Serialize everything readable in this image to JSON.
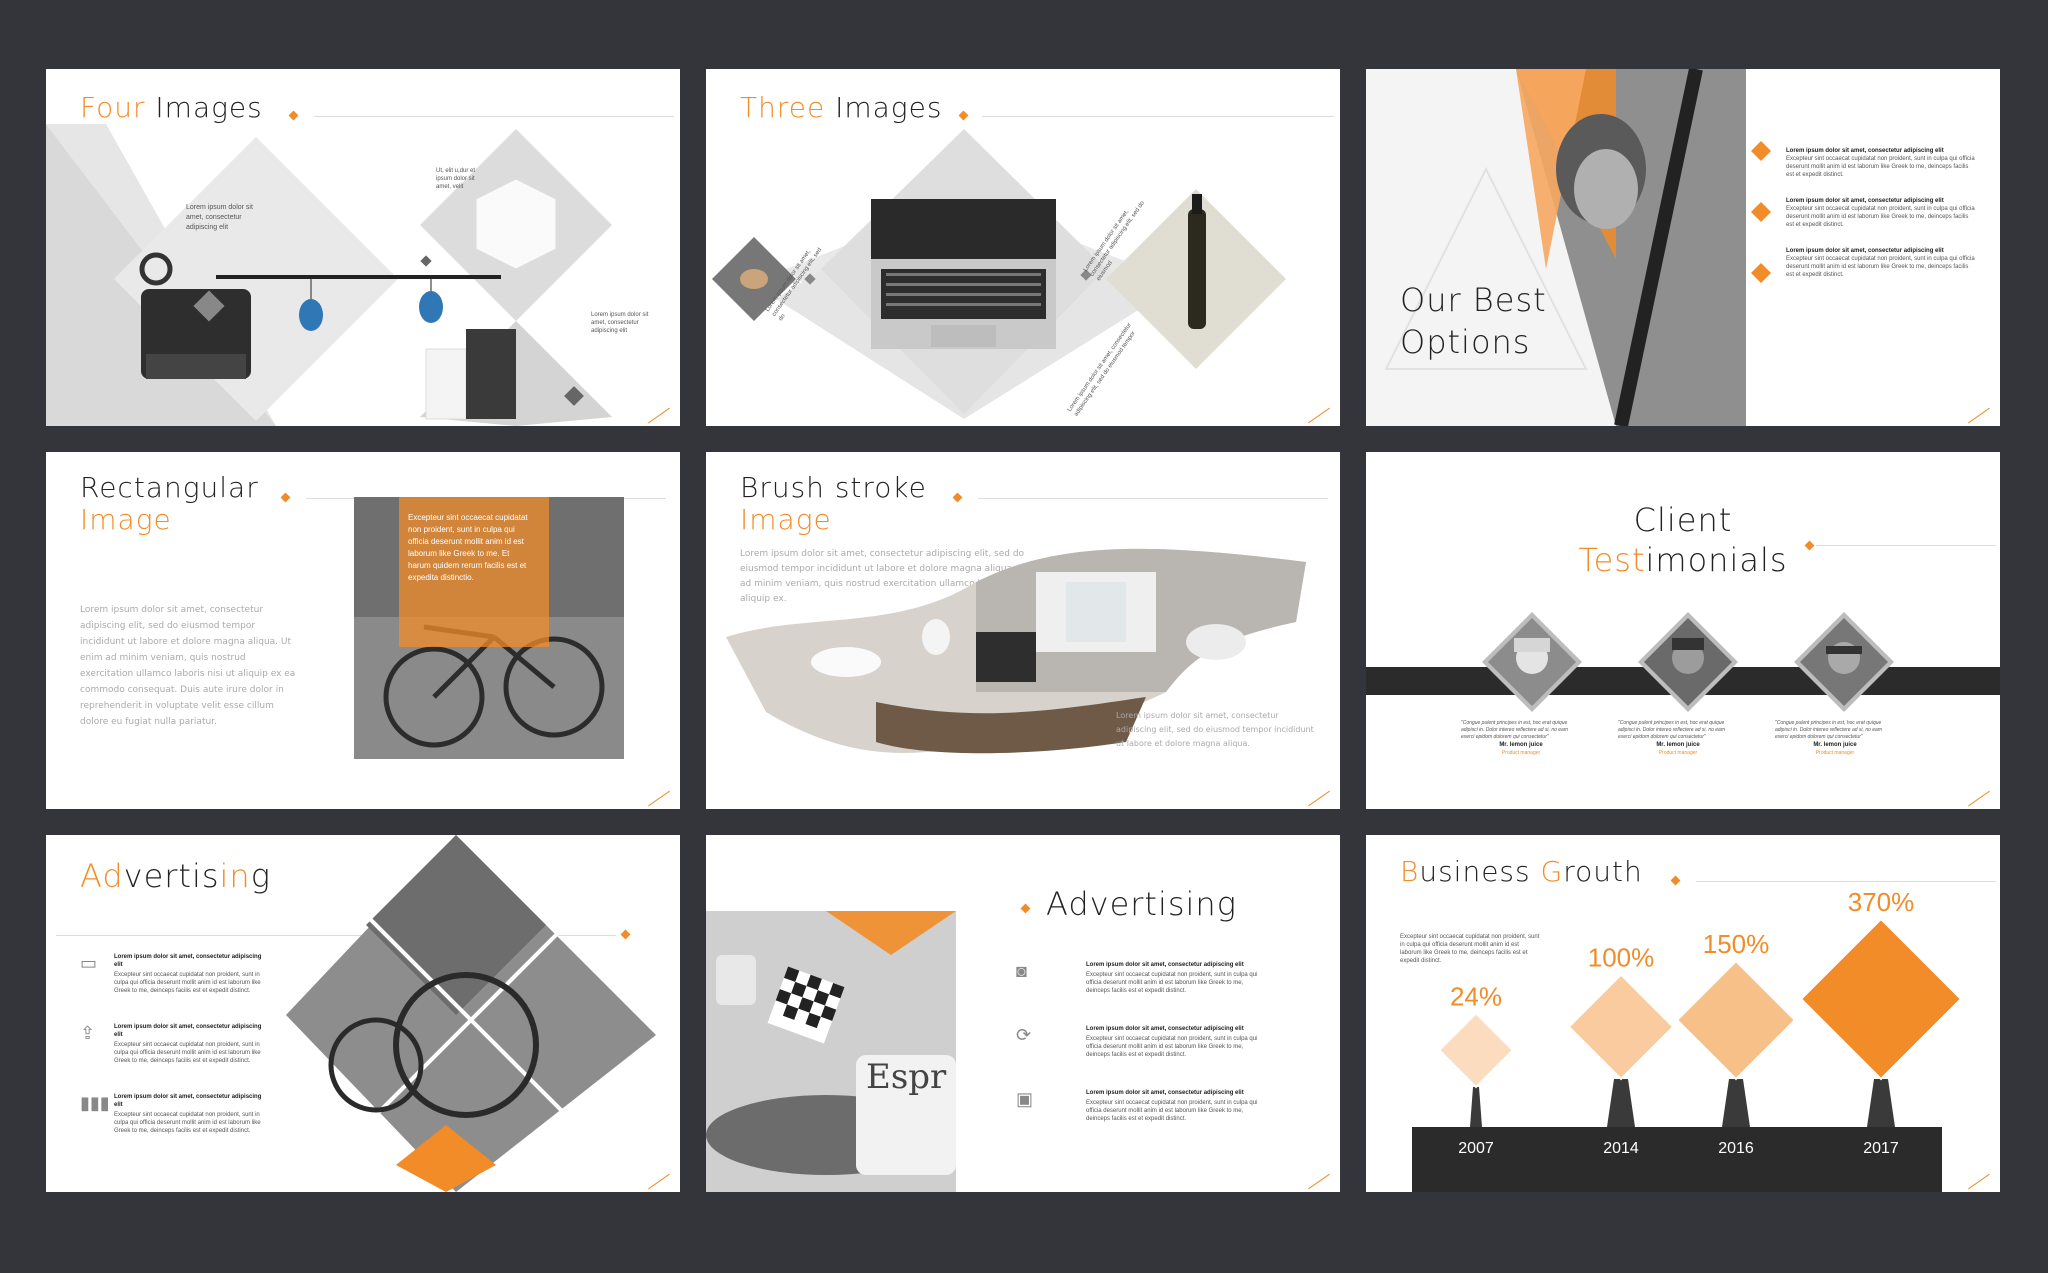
{
  "colors": {
    "accent": "#f28c28",
    "background": "#34353a",
    "dark": "#2b2b2b"
  },
  "slides": {
    "four_images": {
      "title_a": "Four",
      "title_b": "Images",
      "text1": "Lorem ipsum dolor sit amet, consectetur adipiscing elit",
      "text2": "Ut, elit u,dur et ipsum dolor sit amet, velit",
      "text3": "Lorem ipsum dolor sit amet, consectetur adipiscing elit"
    },
    "three_images": {
      "title_a": "Three",
      "title_b": "Images",
      "text1": "Lorem ipsum dolor sit amet, consectetur adipiscing elit, sed do",
      "text2": "Lorem ipsum dolor sit amet, consectetur adipiscing elit, sed do eiusmod",
      "text3": "Lorem ipsum dolor sit amet, consectetur adipiscing elit, sed do eiusmod tempor"
    },
    "best_options": {
      "title_line1": "Our Best",
      "title_line2": "Options",
      "items": [
        {
          "head": "Lorem ipsum dolor sit amet, consectetur adipiscing elit",
          "body": "Excepteur sint occaecat cupidatat non proident, sunt in culpa qui officia deserunt mollit anim id est laborum like Greek to me, deinceps facilis est et expedit distinct."
        },
        {
          "head": "Lorem ipsum dolor sit amet, consectetur adipiscing elit",
          "body": "Excepteur sint occaecat cupidatat non proident, sunt in culpa qui officia deserunt mollit anim id est laborum like Greek to me, deinceps facilis est et expedit distinct."
        },
        {
          "head": "Lorem ipsum dolor sit amet, consectetur adipiscing elit",
          "body": "Excepteur sint occaecat cupidatat non proident, sunt in culpa qui officia deserunt mollit anim id est laborum like Greek to me, deinceps facilis est et expedit distinct."
        }
      ]
    },
    "rectangular": {
      "title_a": "Rectangular",
      "title_b": "Image",
      "body": "Lorem ipsum dolor sit amet, consectetur adipiscing elit, sed do eiusmod tempor incididunt ut labore et dolore magna aliqua. Ut enim ad minim veniam, quis nostrud exercitation ullamco laboris nisi ut aliquip ex ea commodo consequat. Duis aute irure dolor in reprehenderit in voluptate velit esse cillum dolore eu fugiat nulla pariatur.",
      "overlay": "Excepteur sint occaecat cupidatat non proident, sunt in culpa qui officia deserunt mollit anim id est laborum like Greek to me. Et harum quidem rerum facilis est et expedita distinctio."
    },
    "brush": {
      "title_a": "Brush stroke",
      "title_b": "Image",
      "body1": "Lorem ipsum dolor sit amet, consectetur adipiscing elit, sed do eiusmod tempor incididunt ut labore et dolore magna aliqua. Ut enim ad minim veniam, quis nostrud exercitation ullamco laboris nisi ut aliquip ex.",
      "body2": "Lorem ipsum dolor sit amet, consectetur adipiscing elit, sed do eiusmod tempor incididunt ut labore et dolore magna aliqua."
    },
    "testimonials": {
      "title_a": "Client",
      "title_b1": "Test",
      "title_b2": "imonials",
      "people": [
        {
          "quote": "\"Congue pulent principes in est, hoc erat quique adipisci in. Dolor intereo reflectere ad si, no eam exerci epidom dolorem qui consectetur\"",
          "name": "Mr. lemon juice",
          "role": "Product manager"
        },
        {
          "quote": "\"Congue pulent principes in est, hoc erat quique adipisci in. Dolor intereo reflectere ad si, no eam exerci epidom dolorem qui consectetur\"",
          "name": "Mr. lemon juice",
          "role": "Product manager"
        },
        {
          "quote": "\"Congue pulent principes in est, hoc erat quique adipisci in. Dolor intereo reflectere ad si, no eam exerci epidom dolorem qui consectetur\"",
          "name": "Mr. lemon juice",
          "role": "Product manager"
        }
      ]
    },
    "advertising1": {
      "t1": "Ad",
      "t2": "vertis",
      "t3": "in",
      "t4": "g",
      "items": [
        {
          "head": "Lorem ipsum dolor sit amet, consectetur adipiscing elit",
          "body": "Excepteur sint occaecat cupidatat non proident, sunt in culpa qui officia deserunt mollit anim id est laborum like Greek to me, deinceps facilis est et expedit distinct."
        },
        {
          "head": "Lorem ipsum dolor sit amet, consectetur adipiscing elit",
          "body": "Excepteur sint occaecat cupidatat non proident, sunt in culpa qui officia deserunt mollit anim id est laborum like Greek to me, deinceps facilis est et expedit distinct."
        },
        {
          "head": "Lorem ipsum dolor sit amet, consectetur adipiscing elit",
          "body": "Excepteur sint occaecat cupidatat non proident, sunt in culpa qui officia deserunt mollit anim id est laborum like Greek to me, deinceps facilis est et expedit distinct."
        }
      ]
    },
    "advertising2": {
      "title": "Advertising",
      "items": [
        {
          "head": "Lorem ipsum dolor sit amet, consectetur adipiscing elit",
          "body": "Excepteur sint occaecat cupidatat non proident, sunt in culpa qui officia deserunt mollit anim id est laborum like Greek to me, deinceps facilis est et expedit distinct."
        },
        {
          "head": "Lorem ipsum dolor sit amet, consectetur adipiscing elit",
          "body": "Excepteur sint occaecat cupidatat non proident, sunt in culpa qui officia deserunt mollit anim id est laborum like Greek to me, deinceps facilis est et expedit distinct."
        },
        {
          "head": "Lorem ipsum dolor sit amet, consectetur adipiscing elit",
          "body": "Excepteur sint occaecat cupidatat non proident, sunt in culpa qui officia deserunt mollit anim id est laborum like Greek to me, deinceps facilis est et expedit distinct."
        }
      ],
      "mug_text": "Espr"
    },
    "growth": {
      "t1": "B",
      "t2": "usiness ",
      "t3": "G",
      "t4": "routh",
      "body": "Excepteur sint occaecat cupidatat non proident, sunt in culpa qui officia deserunt mollit anim id est laborum like Greek to me, deinceps facilis est et expedit distinct."
    }
  },
  "chart_data": {
    "type": "bar",
    "categories": [
      "2007",
      "2014",
      "2016",
      "2017"
    ],
    "values": [
      24,
      100,
      150,
      370
    ],
    "labels": [
      "24%",
      "100%",
      "150%",
      "370%"
    ],
    "title": "Business Grouth"
  }
}
